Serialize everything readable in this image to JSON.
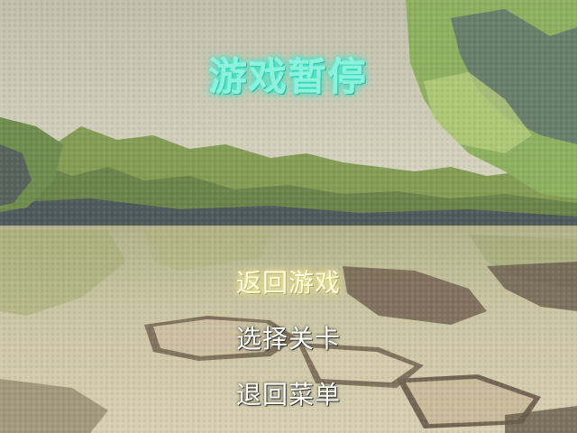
{
  "screen": {
    "title": "游戏暂停",
    "title_color": "#8ff0dc",
    "menu": [
      {
        "label": "返回游戏",
        "selected": true
      },
      {
        "label": "选择关卡",
        "selected": false
      },
      {
        "label": "退回菜单",
        "selected": false
      }
    ]
  },
  "background": {
    "description_colors": {
      "sky": "#c9c8b6",
      "trees": "#5e8a3a",
      "water": "#c8c0a0",
      "stones": "#b6ab90"
    }
  }
}
